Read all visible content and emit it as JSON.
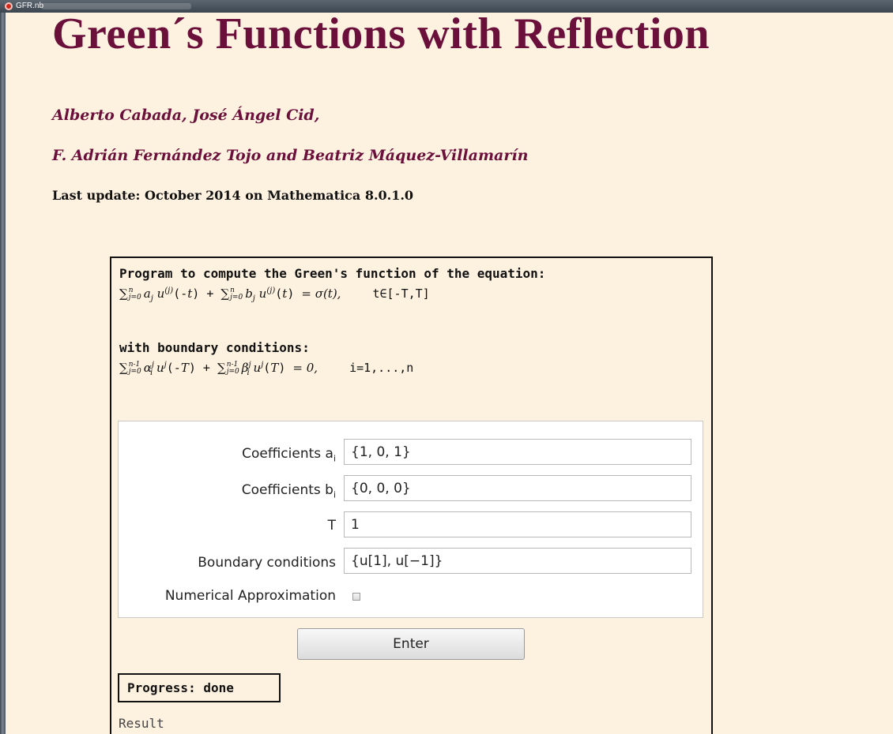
{
  "window": {
    "title": "GFR.nb"
  },
  "header": {
    "title": "Green´s Functions with Reflection",
    "authors_line1": "Alberto Cabada, José Ángel Cid,",
    "authors_line2": "F. Adrián Fernández Tojo and Beatriz Máquez-Villamarín",
    "last_update": "Last update: October 2014  on Mathematica 8.0.1.0"
  },
  "panel": {
    "description": "Program to compute the Green's  function of the equation:",
    "equation_rhs": "= σ(t),",
    "domain": "t∈[-T,T]",
    "bc_label": "with boundary conditions:",
    "bc_rhs": "= 0,",
    "bc_index": "i=1,...,n",
    "form": {
      "coef_a_label": "Coefficients a",
      "coef_a_sub": "i",
      "coef_a_value": "{1, 0, 1}",
      "coef_b_label": "Coefficients b",
      "coef_b_sub": "i",
      "coef_b_value": "{0, 0, 0}",
      "t_label": "T",
      "t_value": "1",
      "bc_field_label": "Boundary conditions",
      "bc_field_value": "{u[1], u[−1]}",
      "numerical_label": "Numerical Approximation",
      "numerical_checked": false
    },
    "enter_label": "Enter",
    "progress": "Progress: done",
    "result_label": "Result"
  }
}
